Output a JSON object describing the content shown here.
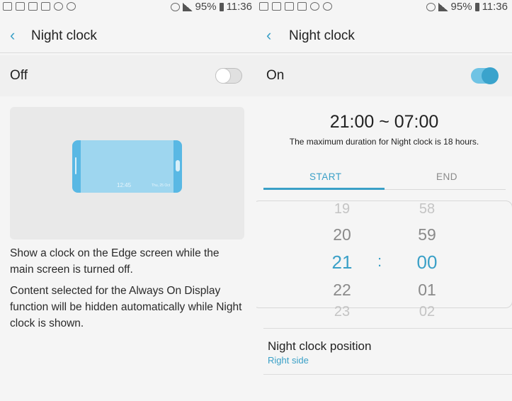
{
  "status_bar": {
    "battery": "95%",
    "time": "11:36"
  },
  "left": {
    "title": "Night clock",
    "switch_label": "Off",
    "preview": {
      "clock": "12:45",
      "date": "Thu, 25 Oct"
    },
    "desc1": "Show a clock on the Edge screen while the main screen is turned off.",
    "desc2": "Content selected for the Always On Display function will be hidden automatically while Night clock is shown."
  },
  "right": {
    "title": "Night clock",
    "switch_label": "On",
    "range": "21:00 ~ 07:00",
    "range_note": "The maximum duration for Night clock is 18 hours.",
    "tabs": {
      "start": "START",
      "end": "END"
    },
    "picker": {
      "hours": [
        "19",
        "20",
        "21",
        "22",
        "23"
      ],
      "minutes": [
        "58",
        "59",
        "00",
        "01",
        "02"
      ],
      "separator": ":"
    },
    "position_label": "Night clock position",
    "position_value": "Right side"
  },
  "colors": {
    "accent": "#3aa0c7",
    "toggle_on": "#6fc3e4",
    "edge_blue": "#59b8e4"
  }
}
